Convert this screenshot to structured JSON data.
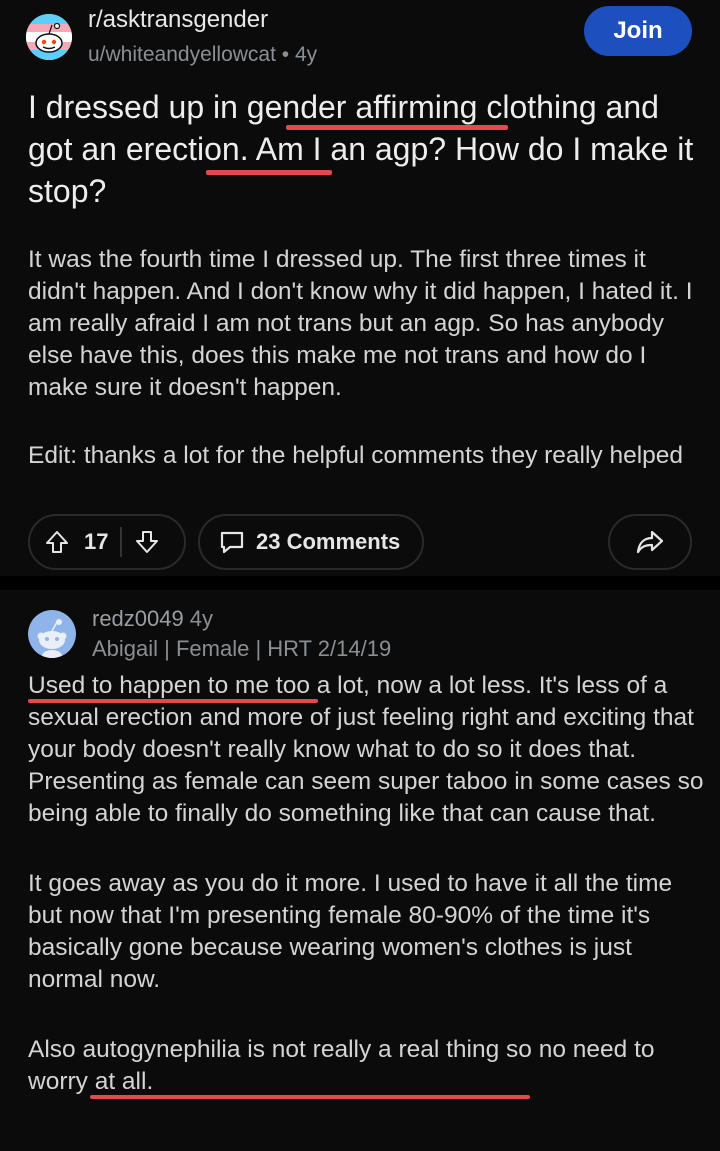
{
  "post": {
    "subreddit": "r/asktransgender",
    "author": "u/whiteandyellowcat",
    "age": "4y",
    "join_label": "Join",
    "title": "I dressed up in gender affirming clothing and got an erection. Am I an agp? How do I make it stop?",
    "body": [
      "It was the fourth time I dressed up. The first three times it didn't happen. And I don't know why it did happen, I hated it. I am really afraid I am not trans but an agp. So has anybody else have this, does this make me not trans and how do I make sure it doesn't happen.",
      "Edit: thanks a lot for the helpful comments they really helped"
    ],
    "upvotes": "17",
    "comments_label": "23 Comments",
    "icons": {
      "upvote": "arrow-up-icon",
      "downvote": "arrow-down-icon",
      "comments": "comment-bubble-icon",
      "share": "share-icon"
    }
  },
  "comment": {
    "username": "redz0049",
    "age": "4y",
    "flair": "Abigail | Female | HRT 2/14/19",
    "paragraphs": [
      "Used to happen to me too a lot, now a lot less. It's less of a sexual erection and more of just feeling right and exciting that your body doesn't really know what to do so it does that. Presenting as female can seem super taboo in some cases so being able to finally do something like that can cause that.",
      "It goes away as you do it more. I used to have it all the time but now that I'm presenting female 80-90% of the time it's basically gone because wearing women's clothes is just normal now.",
      "Also autogynephilia is not really a real thing so no need to worry at all."
    ]
  },
  "colors": {
    "background": "#0b0b0b",
    "join_button": "#1e4fbf",
    "underline_annotation": "#e5484d",
    "muted_text": "#8b8f93"
  }
}
